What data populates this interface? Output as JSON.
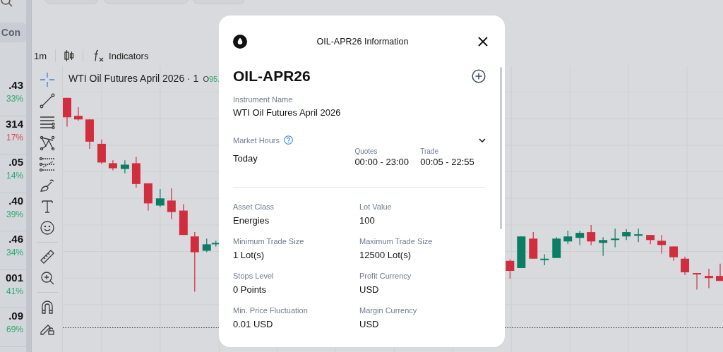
{
  "sidebar": {
    "tab_label": "Con",
    "quotes": [
      {
        "price": ".43",
        "change": "33%",
        "color": "#2ea96b"
      },
      {
        "price": "314",
        "change": "17%",
        "color": "#d9454f"
      },
      {
        "price": ".05",
        "change": "14%",
        "color": "#2ea96b"
      },
      {
        "price": ".40",
        "change": "39%",
        "color": "#2ea96b"
      },
      {
        "price": ".46",
        "change": "34%",
        "color": "#2ea96b"
      },
      {
        "price": "001",
        "change": "41%",
        "color": "#2ea96b"
      },
      {
        "price": ".09",
        "change": "69%",
        "color": "#2ea96b"
      }
    ]
  },
  "toolbar": {
    "interval": "1m",
    "indicators_label": "Indicators"
  },
  "drawing_tools": [
    {
      "kind": "crosshair",
      "selected": true
    },
    {
      "kind": "trendline",
      "selected": false
    },
    {
      "kind": "lines",
      "selected": false
    },
    {
      "kind": "pattern",
      "selected": false
    },
    {
      "kind": "fib",
      "selected": false
    },
    {
      "kind": "brush",
      "selected": false
    },
    {
      "kind": "text",
      "selected": false
    },
    {
      "kind": "emoji",
      "selected": false
    },
    {
      "kind": "ruler",
      "selected": false
    },
    {
      "kind": "zoom",
      "selected": false
    },
    {
      "kind": "magnet",
      "selected": false
    },
    {
      "kind": "lock",
      "selected": false
    }
  ],
  "chart": {
    "title": "WTI Oil Futures April 2026 · 1",
    "open_label": "O",
    "open_value": "95."
  },
  "modal": {
    "title": "OIL-APR26 Information",
    "symbol": "OIL-APR26",
    "instrument_label": "Instrument Name",
    "instrument_name": "WTI Oil Futures April 2026",
    "market_hours": {
      "label": "Market Hours",
      "day": "Today",
      "columns": [
        {
          "label": "Quotes",
          "value": "00:00 - 23:00"
        },
        {
          "label": "Trade",
          "value": "00:05 - 22:55"
        }
      ]
    },
    "details": [
      {
        "label": "Asset Class",
        "value": "Energies"
      },
      {
        "label": "Lot Value",
        "value": "100"
      },
      {
        "label": "Minimum Trade Size",
        "value": "1 Lot(s)"
      },
      {
        "label": "Maximum Trade Size",
        "value": "12500 Lot(s)"
      },
      {
        "label": "Stops Level",
        "value": "0 Points"
      },
      {
        "label": "Profit Currency",
        "value": "USD"
      },
      {
        "label": "Min. Price Fluctuation",
        "value": "0.01 USD"
      },
      {
        "label": "Margin Currency",
        "value": "USD"
      }
    ]
  }
}
